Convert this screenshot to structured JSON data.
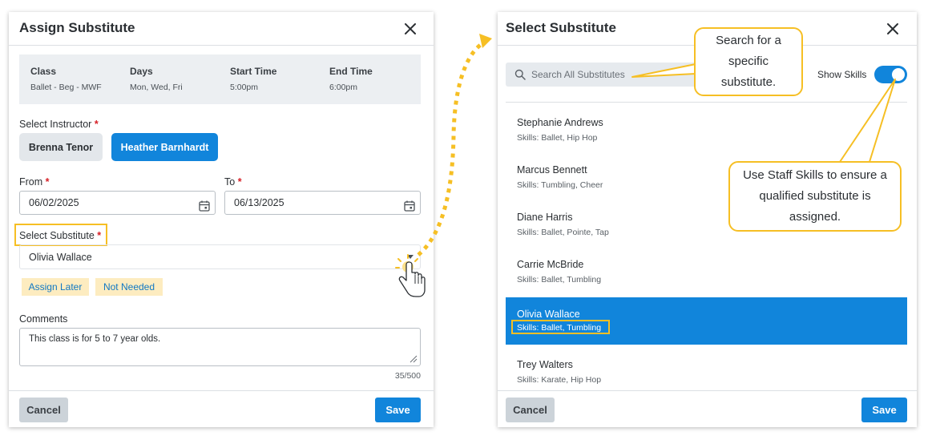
{
  "assign_dialog": {
    "title": "Assign Substitute",
    "info": [
      {
        "label": "Class",
        "value": "Ballet - Beg - MWF"
      },
      {
        "label": "Days",
        "value": "Mon, Wed, Fri"
      },
      {
        "label": "Start Time",
        "value": "5:00pm"
      },
      {
        "label": "End Time",
        "value": "6:00pm"
      }
    ],
    "instructor_label": "Select Instructor",
    "instructors": [
      "Brenna Tenor",
      "Heather Barnhardt"
    ],
    "selected_instructor": "Heather Barnhardt",
    "from_label": "From",
    "from_value": "06/02/2025",
    "to_label": "To",
    "to_value": "06/13/2025",
    "substitute_label": "Select Substitute",
    "substitute_value": "Olivia Wallace",
    "assign_later": "Assign Later",
    "not_needed": "Not Needed",
    "comments_label": "Comments",
    "comments_value": "This class is for 5 to 7 year olds.",
    "char_count": "35/500",
    "cancel": "Cancel",
    "save": "Save",
    "required_mark": "*"
  },
  "select_dialog": {
    "title": "Select Substitute",
    "search_placeholder": "Search All Substitutes",
    "show_skills_label": "Show Skills",
    "show_skills_on": true,
    "substitutes": [
      {
        "name": "Stephanie Andrews",
        "skills": "Skills: Ballet, Hip Hop"
      },
      {
        "name": "Marcus Bennett",
        "skills": "Skills: Tumbling, Cheer"
      },
      {
        "name": "Diane Harris",
        "skills": "Skills: Ballet, Pointe, Tap"
      },
      {
        "name": "Carrie McBride",
        "skills": "Skills: Ballet, Tumbling"
      },
      {
        "name": "Olivia Wallace",
        "skills": "Skills: Ballet, Tumbling"
      },
      {
        "name": "Trey Walters",
        "skills": "Skills: Karate, Hip Hop"
      }
    ],
    "selected_index": 4,
    "cancel": "Cancel",
    "save": "Save"
  },
  "callouts": {
    "search": "Search for a specific substitute.",
    "skills": "Use Staff Skills to ensure a qualified substitute is assigned."
  },
  "colors": {
    "primary": "#1185db",
    "highlight": "#f6bf24",
    "tag_bg": "#fdecc0",
    "required": "#d61f26"
  }
}
